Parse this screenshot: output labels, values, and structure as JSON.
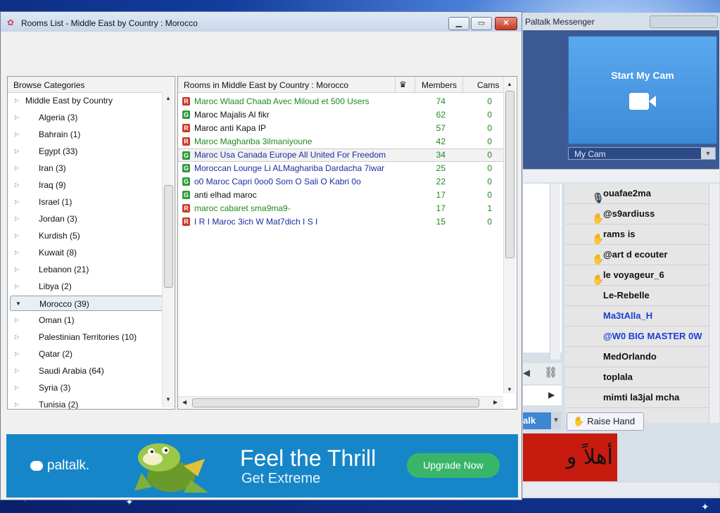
{
  "background_window": {
    "title": "Paltalk Messenger",
    "start_cam_label": "Start My Cam",
    "my_cam_label": "My Cam",
    "users": [
      {
        "name": "ouafae2ma",
        "icon": "mic-icon",
        "color": "#111111"
      },
      {
        "name": "@s9ardiuss",
        "icon": "raised-hand-icon",
        "color": "#111111"
      },
      {
        "name": "rams is",
        "icon": "raised-hand-icon",
        "color": "#111111"
      },
      {
        "name": "@art d ecouter",
        "icon": "raised-hand-icon",
        "color": "#111111"
      },
      {
        "name": "le voyageur_6",
        "icon": "raised-hand-icon",
        "color": "#111111"
      },
      {
        "name": "Le-Rebelle",
        "icon": "",
        "color": "#111111"
      },
      {
        "name": "Ma3tAlla_H",
        "icon": "",
        "color": "#1a3fd0"
      },
      {
        "name": "@W0 BIG MASTER 0W",
        "icon": "",
        "color": "#1a3fd0"
      },
      {
        "name": "MedOrlando",
        "icon": "",
        "color": "#111111"
      },
      {
        "name": "toplala",
        "icon": "",
        "color": "#111111"
      },
      {
        "name": "mimti la3jal mcha",
        "icon": "",
        "color": "#111111"
      }
    ],
    "talk_label": "alk",
    "raise_hand_label": "Raise Hand",
    "arabic_text": "أهلاً و"
  },
  "window": {
    "title": "Rooms List - Middle East by Country : Morocco"
  },
  "categories": {
    "header": "Browse Categories",
    "root": "Middle East by Country",
    "items": [
      {
        "label": "Algeria (3)"
      },
      {
        "label": "Bahrain (1)"
      },
      {
        "label": "Egypt (33)"
      },
      {
        "label": "Iran (3)"
      },
      {
        "label": "Iraq (9)"
      },
      {
        "label": "Israel (1)"
      },
      {
        "label": "Jordan (3)"
      },
      {
        "label": "Kurdish (5)"
      },
      {
        "label": "Kuwait (8)"
      },
      {
        "label": "Lebanon (21)"
      },
      {
        "label": "Libya (2)"
      },
      {
        "label": "Morocco (39)",
        "selected": true
      },
      {
        "label": "Oman (1)"
      },
      {
        "label": "Palestinian Territories (10)"
      },
      {
        "label": "Qatar (2)"
      },
      {
        "label": "Saudi Arabia (64)"
      },
      {
        "label": "Syria (3)"
      },
      {
        "label": "Tunisia (2)"
      }
    ]
  },
  "rooms": {
    "header": {
      "title": "Rooms in Middle East by Country : Morocco",
      "members": "Members",
      "cams": "Cams"
    },
    "rows": [
      {
        "rating": "R",
        "name": "Maroc Wlaad Chaab Avec Miloud et 500 Users",
        "members": "74",
        "cams": "0",
        "color": "#1f8a1f"
      },
      {
        "rating": "G",
        "name": "Maroc Majalis Al fikr",
        "members": "62",
        "cams": "0",
        "color": "#111111"
      },
      {
        "rating": "R",
        "name": "Maroc anti Kapa IP",
        "members": "57",
        "cams": "0",
        "color": "#111111"
      },
      {
        "rating": "R",
        "name": "Maroc Maghariba 3ilmaniyoune",
        "members": "42",
        "cams": "0",
        "color": "#1f8a1f"
      },
      {
        "rating": "G",
        "name": "Maroc Usa Canada Europe All United For Freedom",
        "members": "34",
        "cams": "0",
        "color": "#1a2fa0",
        "selected": true
      },
      {
        "rating": "G",
        "name": "Moroccan Lounge Li ALMaghariba Dardacha 7iwar",
        "members": "25",
        "cams": "0",
        "color": "#1a2fa0"
      },
      {
        "rating": "G",
        "name": "o0 Maroc Capri 0oo0 Som O Sali O Kabri 0o",
        "members": "22",
        "cams": "0",
        "color": "#1a2fa0"
      },
      {
        "rating": "G",
        "name": "anti elhad maroc",
        "members": "17",
        "cams": "0",
        "color": "#111111"
      },
      {
        "rating": "R",
        "name": "maroc cabaret sma9ma9-",
        "members": "17",
        "cams": "1",
        "color": "#1f8a1f"
      },
      {
        "rating": "R",
        "name": "I R I Maroc 3ich W Mat7dich I S I",
        "members": "15",
        "cams": "0",
        "color": "#1a2fa0"
      }
    ]
  },
  "ad": {
    "logo": "paltalk.",
    "headline": "Feel the Thrill",
    "subline": "Get Extreme",
    "button": "Upgrade Now"
  },
  "colors": {
    "members_number": "#1f8a1f",
    "cams_number": "#1f8a1f",
    "ad_background": "#1786c8",
    "upgrade_button": "#39b56a"
  }
}
